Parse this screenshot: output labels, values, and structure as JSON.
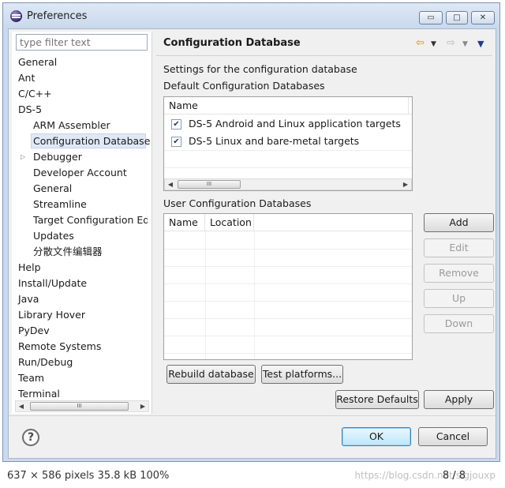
{
  "window": {
    "title": "Preferences",
    "minimize_glyph": "▭",
    "maximize_glyph": "□",
    "close_glyph": "✕"
  },
  "filter": {
    "placeholder": "type filter text"
  },
  "tree": {
    "items": [
      {
        "label": "General",
        "level": 0
      },
      {
        "label": "Ant",
        "level": 0
      },
      {
        "label": "C/C++",
        "level": 0
      },
      {
        "label": "DS-5",
        "level": 0
      },
      {
        "label": "ARM Assembler",
        "level": 1
      },
      {
        "label": "Configuration Database",
        "level": 1,
        "selected": true
      },
      {
        "label": "Debugger",
        "level": 1,
        "collapsed": true
      },
      {
        "label": "Developer Account",
        "level": 1
      },
      {
        "label": "General",
        "level": 1
      },
      {
        "label": "Streamline",
        "level": 1
      },
      {
        "label": "Target Configuration Edi",
        "level": 1
      },
      {
        "label": "Updates",
        "level": 1
      },
      {
        "label": "分散文件编辑器",
        "level": 1
      },
      {
        "label": "Help",
        "level": 0
      },
      {
        "label": "Install/Update",
        "level": 0
      },
      {
        "label": "Java",
        "level": 0
      },
      {
        "label": "Library Hover",
        "level": 0
      },
      {
        "label": "PyDev",
        "level": 0
      },
      {
        "label": "Remote Systems",
        "level": 0
      },
      {
        "label": "Run/Debug",
        "level": 0
      },
      {
        "label": "Team",
        "level": 0
      },
      {
        "label": "Terminal",
        "level": 0
      }
    ]
  },
  "page": {
    "title": "Configuration Database",
    "description": "Settings for the configuration database",
    "default_section_label": "Default Configuration Databases",
    "default_table": {
      "header_name": "Name",
      "rows": [
        {
          "label": "DS-5 Android and Linux application targets",
          "checked": true
        },
        {
          "label": "DS-5 Linux and bare-metal targets",
          "checked": true
        }
      ]
    },
    "user_section_label": "User Configuration Databases",
    "user_table": {
      "header_name": "Name",
      "header_location": "Location"
    }
  },
  "buttons": {
    "add": "Add",
    "edit": "Edit",
    "remove": "Remove",
    "up": "Up",
    "down": "Down",
    "rebuild": "Rebuild database",
    "test_platforms": "Test platforms...",
    "restore_defaults": "Restore Defaults",
    "apply": "Apply",
    "ok": "OK",
    "cancel": "Cancel"
  },
  "status_bar": {
    "dimensions": "637 × 586 pixels  35.8 kB   100%",
    "page": "8 / 8",
    "watermark": "https://blog.csdn.net/sigjouxp"
  },
  "colors": {
    "window_frame": "#c9daef",
    "selection": "#e0e8f6",
    "default_button": "#3c7fb1"
  }
}
